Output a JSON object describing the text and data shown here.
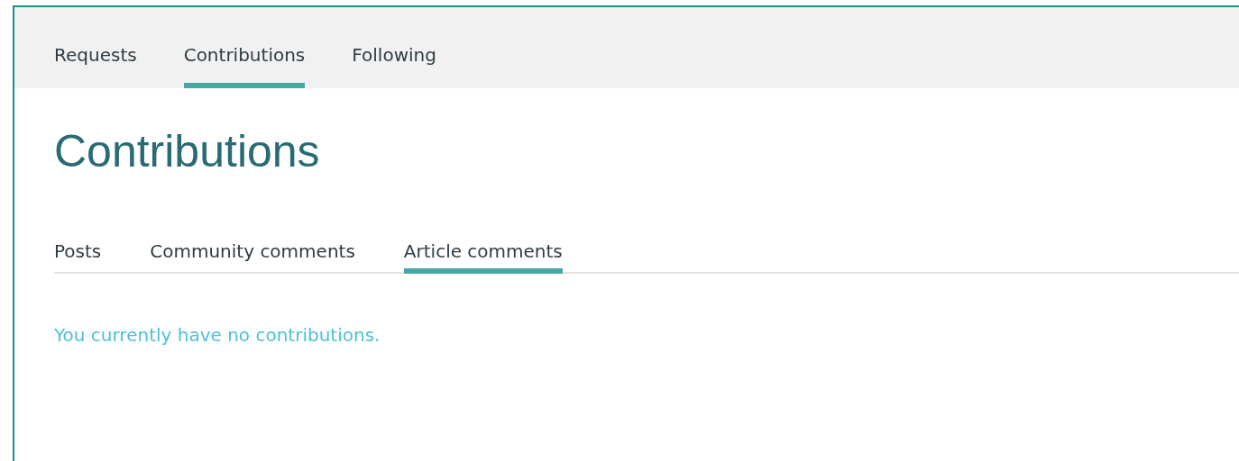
{
  "top_tabs": [
    {
      "label": "Requests",
      "selected": false
    },
    {
      "label": "Contributions",
      "selected": true
    },
    {
      "label": "Following",
      "selected": false
    }
  ],
  "page_title": "Contributions",
  "sub_tabs": [
    {
      "label": "Posts",
      "selected": false
    },
    {
      "label": "Community comments",
      "selected": false
    },
    {
      "label": "Article comments",
      "selected": true
    }
  ],
  "empty_message": "You currently have no contributions."
}
